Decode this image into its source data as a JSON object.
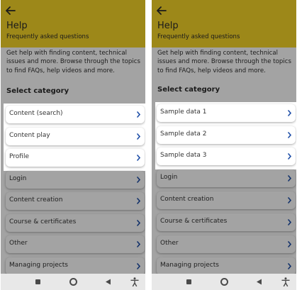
{
  "screens": [
    {
      "header": {
        "title": "Help",
        "subtitle": "Frequently asked questions"
      },
      "intro": "Get help with finding content, technical issues and more. Browse through the topics to find FAQs, help videos and more.",
      "section_title": "Select category",
      "categories": [
        {
          "label": "Content (search)"
        },
        {
          "label": "Content play"
        },
        {
          "label": "Profile"
        },
        {
          "label": "Login"
        },
        {
          "label": "Content creation"
        },
        {
          "label": "Course & certificates"
        },
        {
          "label": "Other"
        },
        {
          "label": "Managing projects"
        }
      ]
    },
    {
      "header": {
        "title": "Help",
        "subtitle": "Frequently asked questions"
      },
      "intro": "Get help with finding content, technical issues and more. Browse through the topics to find FAQs, help videos and more.",
      "section_title": "Select category",
      "categories": [
        {
          "label": "Sample data 1"
        },
        {
          "label": "Sample data 2"
        },
        {
          "label": "Sample data 3"
        },
        {
          "label": "Login"
        },
        {
          "label": "Content creation"
        },
        {
          "label": "Course & certificates"
        },
        {
          "label": "Other"
        },
        {
          "label": "Managing projects"
        }
      ]
    }
  ],
  "colors": {
    "header": "#f6d528",
    "chevron": "#1f4fa8",
    "dim_overlay": "rgba(0,0,0,0.36)"
  },
  "icons": {
    "back": "arrow-left-icon",
    "chevron": "chevron-right-icon",
    "nav_recent": "square-icon",
    "nav_home": "circle-icon",
    "nav_back": "triangle-back-icon",
    "nav_accessibility": "accessibility-icon"
  }
}
